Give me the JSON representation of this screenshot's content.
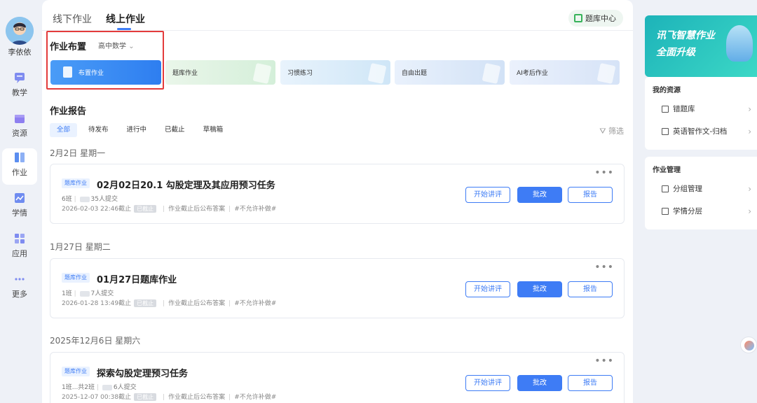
{
  "sidebar": {
    "user_name": "李依依",
    "items": [
      {
        "label": "教学",
        "icon": "chat-icon"
      },
      {
        "label": "资源",
        "icon": "box-icon"
      },
      {
        "label": "作业",
        "icon": "book-icon"
      },
      {
        "label": "学情",
        "icon": "chart-icon"
      },
      {
        "label": "应用",
        "icon": "grid-icon"
      },
      {
        "label": "更多",
        "icon": "dots-icon"
      }
    ]
  },
  "header": {
    "tabs": [
      "线下作业",
      "线上作业"
    ],
    "bank_center": "题库中心"
  },
  "assign": {
    "title": "作业布置",
    "subject": "高中数学",
    "cards": [
      "布置作业",
      "题库作业",
      "习惯练习",
      "自由出题",
      "AI考后作业"
    ]
  },
  "report": {
    "title": "作业报告",
    "filters": [
      "全部",
      "待发布",
      "进行中",
      "已截止",
      "草稿箱"
    ],
    "filter_link": "筛选"
  },
  "groups": [
    {
      "date": "2月2日 星期一",
      "badge": "题库作业",
      "title": "02月02日20.1 勾股定理及其应用预习任务",
      "class": "6班",
      "submitted": "35人提交",
      "deadline": "2026-02-03 22:46截止",
      "status": "已截止",
      "publish": "作业截止后公布答案",
      "makeup": "#不允许补做#",
      "btn_review": "开始讲评",
      "btn_grade": "批改",
      "btn_report": "报告"
    },
    {
      "date": "1月27日 星期二",
      "badge": "题库作业",
      "title": "01月27日题库作业",
      "class": "1班",
      "submitted": "7人提交",
      "deadline": "2026-01-28 13:49截止",
      "status": "已截止",
      "publish": "作业截止后公布答案",
      "makeup": "#不允许补做#",
      "btn_review": "开始讲评",
      "btn_grade": "批改",
      "btn_report": "报告"
    },
    {
      "date": "2025年12月6日 星期六",
      "badge": "题库作业",
      "title": "探索勾股定理预习任务",
      "class": "1班...共2班",
      "submitted": "6人提交",
      "deadline": "2025-12-07 00:38截止",
      "status": "已截止",
      "publish": "作业截止后公布答案",
      "makeup": "#不允许补做#",
      "btn_review": "开始讲评",
      "btn_grade": "批改",
      "btn_report": "报告"
    }
  ],
  "right": {
    "banner_line1": "讯飞智慧作业",
    "banner_line2": "全面升级",
    "my_resources": {
      "title": "我的资源",
      "items": [
        "错题库",
        "英语智作文-归档"
      ]
    },
    "hw_manage": {
      "title": "作业管理",
      "items": [
        "分组管理",
        "学情分层"
      ]
    }
  },
  "colors": {
    "accent": "#3e7cf5",
    "highlight": "#e33b3b",
    "banner": "#1db3b9"
  }
}
